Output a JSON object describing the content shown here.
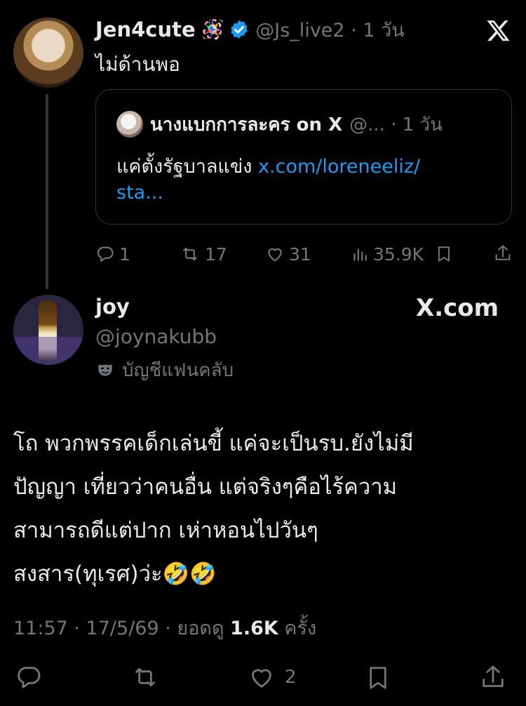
{
  "quoted_tweet": {
    "display_name": "Jen4cute",
    "name_emoji": "🪅",
    "handle_time": "@Js_live2 · 1 วัน",
    "text": "ไม่ด้านพอ",
    "embedded": {
      "name": "นางแบกการละคร on X",
      "handle_time": "@... · 1 วัน",
      "text": "แค่ตั้งรัฐบาลแข่ง ",
      "link_line1": "x.com/loreneeliz/",
      "link_line2": "sta..."
    },
    "stats": {
      "replies": "1",
      "retweets": "17",
      "likes": "31",
      "views": "35.9K"
    }
  },
  "main_tweet": {
    "display_name": "joy",
    "handle": "@joynakubb",
    "badge_text": "บัญชีแฟนคลับ",
    "site_label": "X.com",
    "body_lines": [
      "โถ พวกพรรคเด็กเล่นขี้ แค่จะเป็นรบ.ยังไม่มี",
      "ปัญญา เที่ยวว่าคนอื่น แต่จริงๆคือไร้ความ",
      "สามารถดีแต่ปาก เห่าหอนไปวันๆ",
      "สงสาร(ทุเรศ)ว่ะ🤣🤣"
    ],
    "timestamp": "11:57 · 17/5/69 · ยอดดู ",
    "view_count": "1.6K",
    "view_suffix": " ครั้ง",
    "like_count": "2"
  },
  "colors": {
    "background": "#000000",
    "text": "#e7e9ea",
    "secondary": "#71767b",
    "link": "#1d9bf0",
    "verified": "#1d9bf0"
  }
}
